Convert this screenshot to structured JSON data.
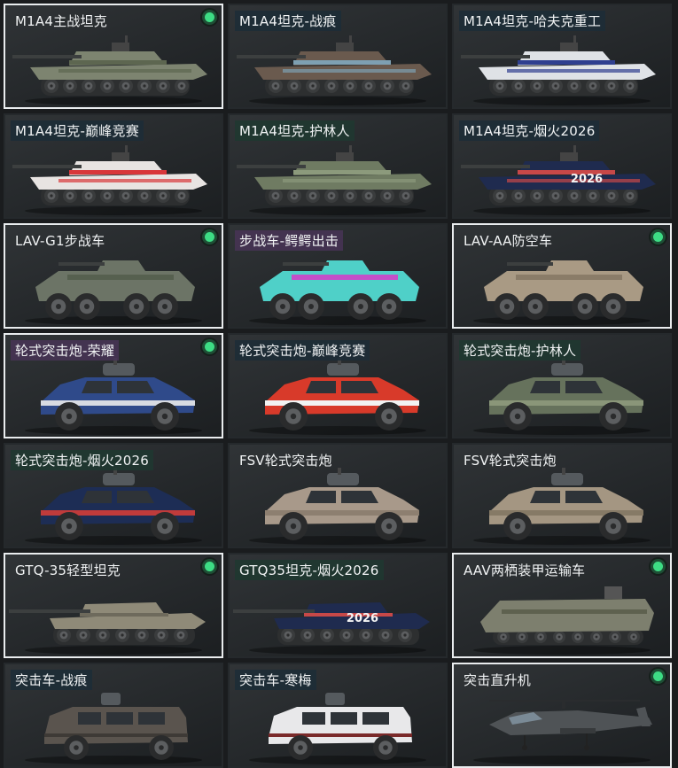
{
  "cards": [
    {
      "title": "M1A4主战坦克",
      "owned": true,
      "kind": "tank",
      "label_style": "plain",
      "color": "#7d8470",
      "accent": "#5d6650",
      "text": ""
    },
    {
      "title": "M1A4坦克-战痕",
      "owned": false,
      "kind": "tank",
      "label_style": "blue",
      "color": "#6a5a4e",
      "accent": "#7ea0b2",
      "text": ""
    },
    {
      "title": "M1A4坦克-哈夫克重工",
      "owned": false,
      "kind": "tank",
      "label_style": "blue",
      "color": "#dfe2e6",
      "accent": "#2f3f8f",
      "text": ""
    },
    {
      "title": "M1A4坦克-巅峰竞赛",
      "owned": false,
      "kind": "tank",
      "label_style": "blue",
      "color": "#e8e4e2",
      "accent": "#d8373a",
      "text": ""
    },
    {
      "title": "M1A4坦克-护林人",
      "owned": false,
      "kind": "tank",
      "label_style": "green",
      "color": "#6f7b62",
      "accent": "#8c9a7c",
      "text": ""
    },
    {
      "title": "M1A4坦克-烟火2026",
      "owned": false,
      "kind": "tank",
      "label_style": "blue",
      "color": "#1f2b4f",
      "accent": "#c74848",
      "text": "2026"
    },
    {
      "title": "LAV-G1步战车",
      "owned": true,
      "kind": "apc",
      "label_style": "plain",
      "color": "#6c7466",
      "accent": "#56604f",
      "text": ""
    },
    {
      "title": "步战车-鳄鳄出击",
      "owned": false,
      "kind": "apc",
      "label_style": "purple",
      "color": "#4fd0c8",
      "accent": "#c44fc9",
      "text": ""
    },
    {
      "title": "LAV-AA防空车",
      "owned": true,
      "kind": "apc",
      "label_style": "plain",
      "color": "#a99a84",
      "accent": "#8a7c68",
      "text": ""
    },
    {
      "title": "轮式突击炮-荣耀",
      "owned": true,
      "kind": "car",
      "label_style": "purple",
      "color": "#2f4a8a",
      "accent": "#d8dbe2",
      "text": ""
    },
    {
      "title": "轮式突击炮-巅峰竞赛",
      "owned": false,
      "kind": "car",
      "label_style": "blue",
      "color": "#d83a2a",
      "accent": "#f2f2f2",
      "text": ""
    },
    {
      "title": "轮式突击炮-护林人",
      "owned": false,
      "kind": "car",
      "label_style": "green",
      "color": "#66725c",
      "accent": "#8a9679",
      "text": ""
    },
    {
      "title": "轮式突击炮-烟火2026",
      "owned": false,
      "kind": "car",
      "label_style": "green",
      "color": "#1d2d55",
      "accent": "#c03b3b",
      "text": ""
    },
    {
      "title": "FSV轮式突击炮",
      "owned": false,
      "kind": "car",
      "label_style": "none",
      "color": "#a8998a",
      "accent": "#8d7f70",
      "text": ""
    },
    {
      "title": "FSV轮式突击炮",
      "owned": false,
      "kind": "car",
      "label_style": "none",
      "color": "#a49682",
      "accent": "#867a66",
      "text": ""
    },
    {
      "title": "GTQ-35轻型坦克",
      "owned": true,
      "kind": "light",
      "label_style": "plain",
      "color": "#8f8a78",
      "accent": "#6e6a5c",
      "text": ""
    },
    {
      "title": "GTQ35坦克-烟火2026",
      "owned": false,
      "kind": "light",
      "label_style": "green",
      "color": "#1f2b4f",
      "accent": "#c74848",
      "text": "2026"
    },
    {
      "title": "AAV两栖装甲运输车",
      "owned": true,
      "kind": "aav",
      "label_style": "plain",
      "color": "#7d7f6e",
      "accent": "#5e614f",
      "text": ""
    },
    {
      "title": "突击车-战痕",
      "owned": false,
      "kind": "truck",
      "label_style": "blue",
      "color": "#5a544e",
      "accent": "#3e3a36",
      "text": ""
    },
    {
      "title": "突击车-寒梅",
      "owned": false,
      "kind": "truck",
      "label_style": "blue",
      "color": "#e8e8ea",
      "accent": "#7a2a2a",
      "text": ""
    },
    {
      "title": "突击直升机",
      "owned": true,
      "kind": "heli",
      "label_style": "none",
      "color": "#4f5356",
      "accent": "#373a3c",
      "text": ""
    }
  ]
}
